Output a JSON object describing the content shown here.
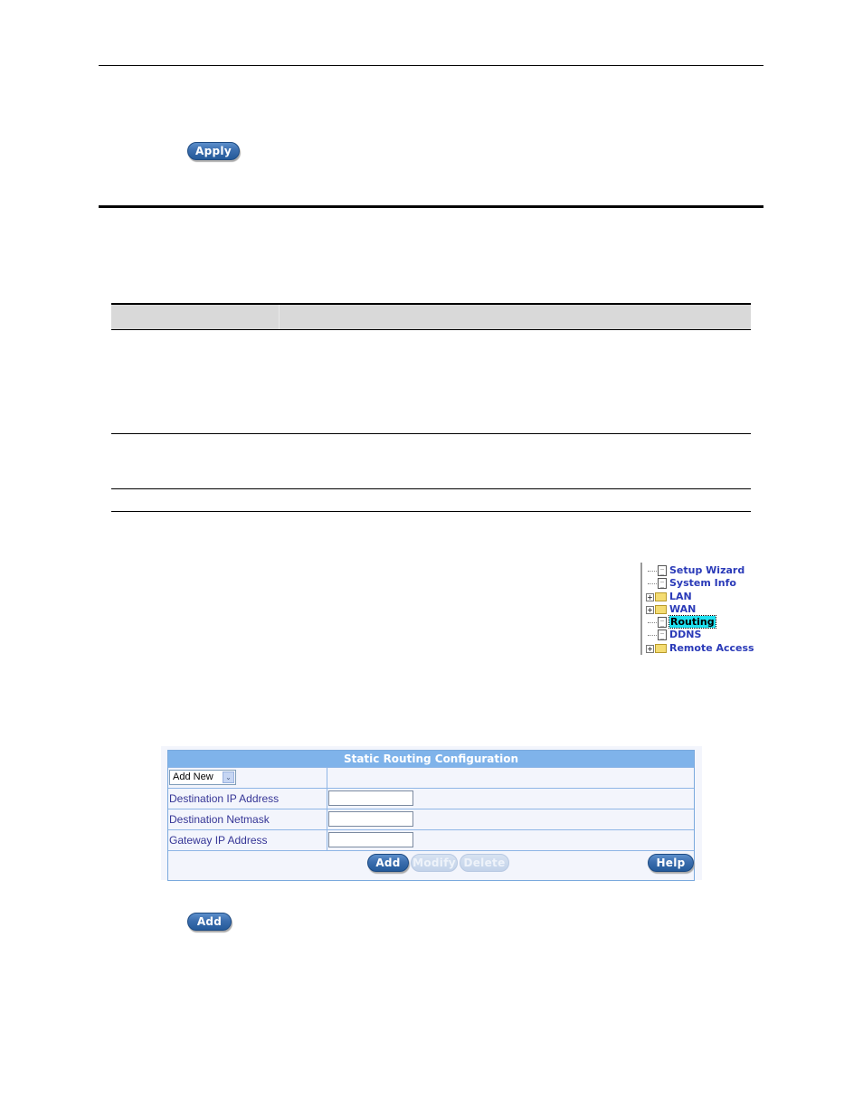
{
  "top_section": {
    "apply_button": "Apply"
  },
  "doc_table": {
    "headers": [
      "",
      ""
    ],
    "rows": [
      [
        "",
        ""
      ],
      [
        "",
        ""
      ],
      [
        "",
        ""
      ]
    ]
  },
  "nav_tree": {
    "items": [
      {
        "label": "Setup Wizard",
        "type": "page",
        "expandable": false,
        "selected": false
      },
      {
        "label": "System Info",
        "type": "page",
        "expandable": false,
        "selected": false
      },
      {
        "label": "LAN",
        "type": "folder",
        "expandable": true,
        "selected": false
      },
      {
        "label": "WAN",
        "type": "folder",
        "expandable": true,
        "selected": false
      },
      {
        "label": "Routing",
        "type": "page",
        "expandable": false,
        "selected": true
      },
      {
        "label": "DDNS",
        "type": "page",
        "expandable": false,
        "selected": false
      },
      {
        "label": "Remote Access",
        "type": "folder",
        "expandable": true,
        "selected": false
      }
    ],
    "expand_glyph": "+"
  },
  "static_routing": {
    "title": "Static Routing Configuration",
    "mode_select": {
      "value": "Add New",
      "arrow": "⌄"
    },
    "fields": [
      {
        "label": "Destination IP Address",
        "value": ""
      },
      {
        "label": "Destination Netmask",
        "value": ""
      },
      {
        "label": "Gateway IP Address",
        "value": ""
      }
    ],
    "buttons": {
      "add": "Add",
      "modify": "Modify",
      "delete": "Delete",
      "help": "Help"
    }
  },
  "bottom_section": {
    "add_button": "Add"
  }
}
